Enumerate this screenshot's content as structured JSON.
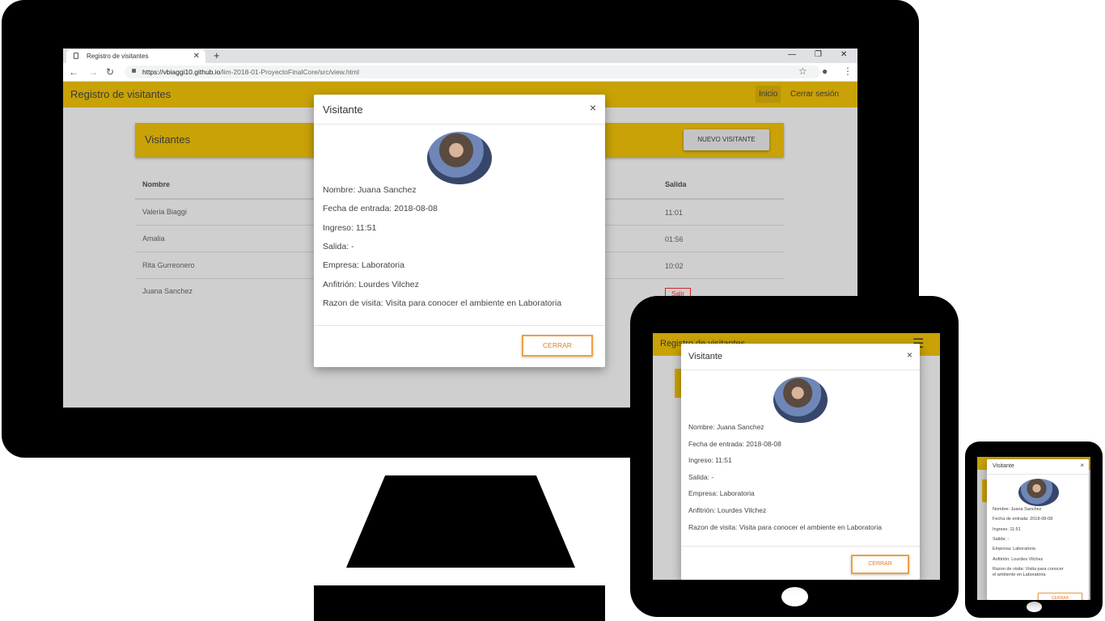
{
  "browser": {
    "tab_title": "Registro de visitantes",
    "url_host": "https://vbiaggi10.github.io",
    "url_path": "/lim-2018-01-ProyectoFinalCore/src/view.html"
  },
  "app": {
    "title": "Registro de visitantes",
    "nav": [
      "Inicio",
      "Cerrar sesión"
    ]
  },
  "panel": {
    "title": "Visitantes",
    "new_button": "NUEVO VISITANTE"
  },
  "table": {
    "headers": [
      "Nombre",
      "Salida"
    ],
    "rows": [
      {
        "nombre": "Valeria Biaggi",
        "salida": "11:01"
      },
      {
        "nombre": "Amalia",
        "salida": "01:56"
      },
      {
        "nombre": "Rita Gurreonero",
        "salida": "10:02"
      },
      {
        "nombre": "Juana Sanchez",
        "salida": "Salir"
      }
    ]
  },
  "modal": {
    "title": "Visitante",
    "close_symbol": "×",
    "fields": [
      "Nombre: Juana Sanchez",
      "Fecha de entrada: 2018-08-08",
      "Ingreso: 11:51",
      "Salida: -",
      "Empresa: Laboratoria",
      "Anfitrión: Lourdes Vilchez",
      "Razon de visita: Visita para conocer el ambiente en Laboratoria"
    ],
    "phone_reason_lines": [
      "Razon de visita: Visita para conocer",
      "el ambiente en Laboratoria"
    ],
    "close_button": "CERRAR"
  },
  "colors": {
    "brand": "#c8a206",
    "accent": "#f0a040",
    "danger": "#dd2222"
  },
  "icons": [
    "document-icon",
    "close-tab-icon",
    "new-tab-icon",
    "minimize-icon",
    "restore-icon",
    "close-window-icon",
    "back-icon",
    "forward-icon",
    "reload-icon",
    "lock-icon",
    "star-icon",
    "account-icon",
    "menu-dots-icon",
    "hamburger-icon",
    "modal-close-icon"
  ]
}
